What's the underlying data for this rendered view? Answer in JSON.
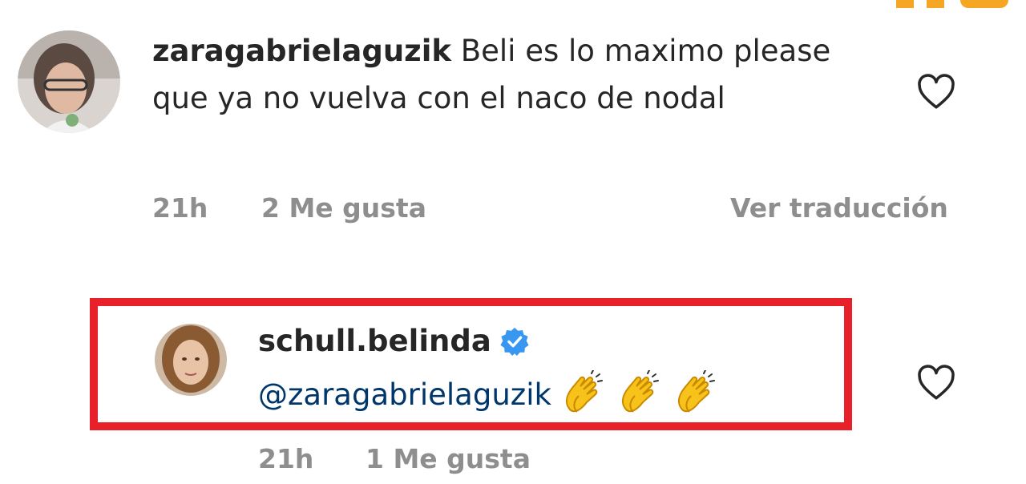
{
  "colors": {
    "text": "#262626",
    "secondary_text": "#8e8e8e",
    "mention": "#00376b",
    "highlight_border": "#e8202a",
    "verified_badge": "#3897f0",
    "corner_mark": "#f5a623"
  },
  "comments": [
    {
      "username": "zaragabrielaguzik",
      "text": "Beli es lo maximo please que ya no vuelva con el naco de nodal",
      "time": "21h",
      "likes": "2 Me gusta",
      "translate": "Ver traducción",
      "avatar_icon": "avatar-photo",
      "like_icon": "heart-outline-icon"
    },
    {
      "username": "schull.belinda",
      "verified_icon": "verified-badge-icon",
      "mention": "@zaragabrielaguzik",
      "emojis": [
        "clapping-hands-emoji",
        "clapping-hands-emoji",
        "clapping-hands-emoji"
      ],
      "time": "21h",
      "likes": "1 Me gusta",
      "avatar_icon": "avatar-photo",
      "like_icon": "heart-outline-icon",
      "highlighted": true
    }
  ]
}
